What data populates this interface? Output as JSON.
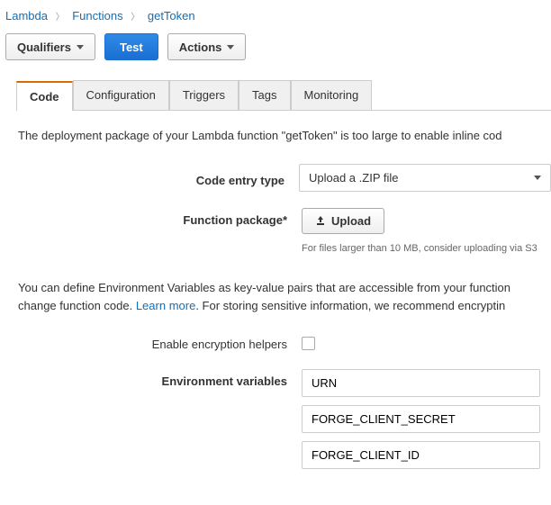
{
  "breadcrumb": {
    "root": "Lambda",
    "mid": "Functions",
    "current": "getToken"
  },
  "toolbar": {
    "qualifiers": "Qualifiers",
    "test": "Test",
    "actions": "Actions"
  },
  "tabs": {
    "code": "Code",
    "configuration": "Configuration",
    "triggers": "Triggers",
    "tags": "Tags",
    "monitoring": "Monitoring"
  },
  "code_panel": {
    "notice": "The deployment package of your Lambda function \"getToken\" is too large to enable inline cod",
    "entry_type_label": "Code entry type",
    "entry_type_value": "Upload a .ZIP file",
    "package_label": "Function package*",
    "upload_button": "Upload",
    "upload_help": "For files larger than 10 MB, consider uploading via S3",
    "env_desc_1": "You can define Environment Variables as key-value pairs that are accessible from your function",
    "env_desc_2": "change function code. ",
    "learn_more": "Learn more",
    "env_desc_3": ". For storing sensitive information, we recommend encryptin",
    "enable_encryption_label": "Enable encryption helpers",
    "env_vars_label": "Environment variables",
    "env_vars": [
      "URN",
      "FORGE_CLIENT_SECRET",
      "FORGE_CLIENT_ID"
    ]
  }
}
